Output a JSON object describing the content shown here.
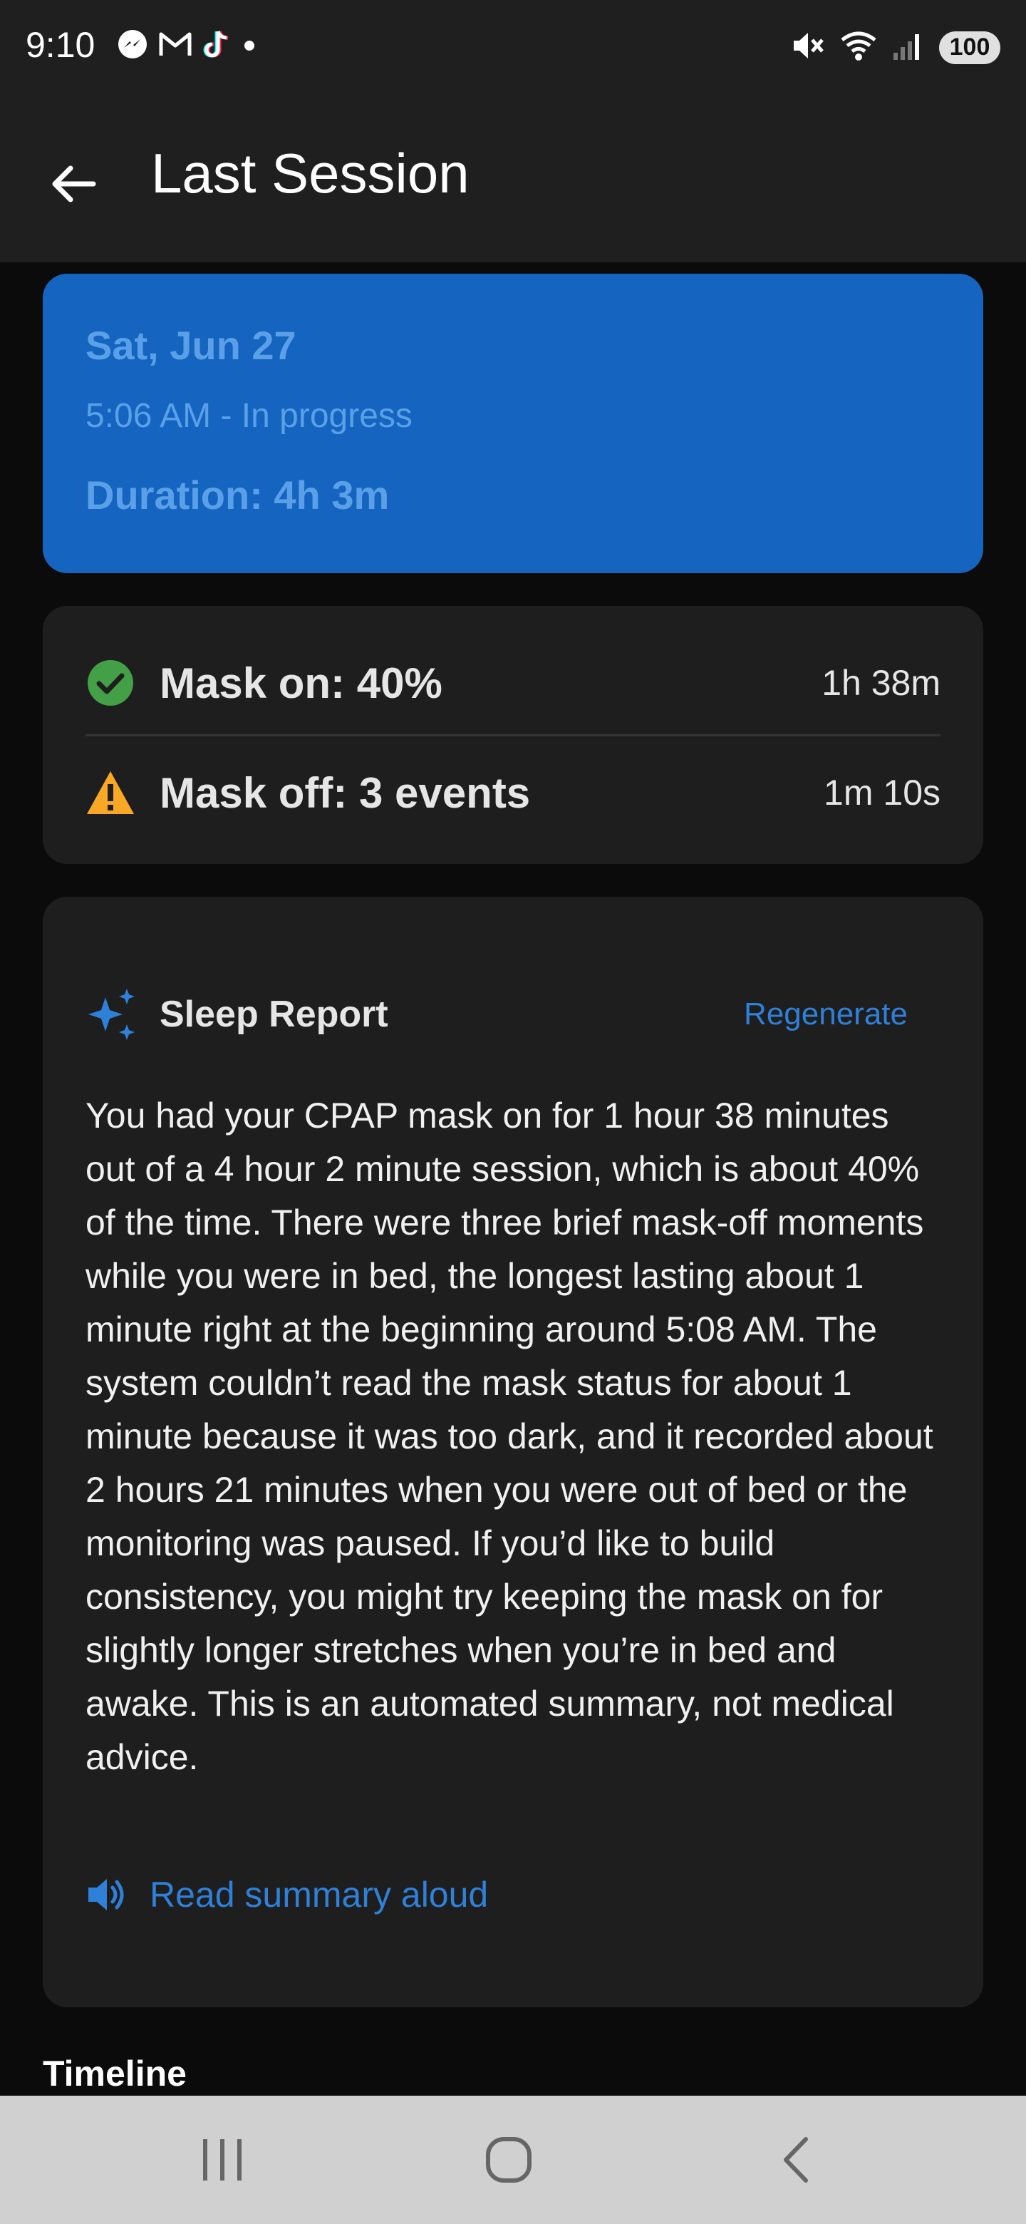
{
  "status_bar": {
    "time": "9:10",
    "battery": "100",
    "notification_icons": [
      "messenger-icon",
      "gmail-icon",
      "tiktok-icon",
      "dot-icon"
    ],
    "system_icons": [
      "mute-icon",
      "wifi-icon",
      "signal-icon",
      "battery-icon"
    ]
  },
  "app_bar": {
    "title": "Last Session"
  },
  "session": {
    "date": "Sat, Jun 27",
    "time_status": "5:06 AM - In progress",
    "duration": "Duration: 4h 3m"
  },
  "mask": {
    "on_label": "Mask on: 40%",
    "on_value": "1h 38m",
    "off_label": "Mask off: 3 events",
    "off_value": "1m 10s"
  },
  "report": {
    "title": "Sleep Report",
    "regenerate": "Regenerate",
    "body": "You had your CPAP mask on for 1 hour 38 minutes out of a 4 hour 2 minute session, which is about 40% of the time. There were three brief mask-off moments while you were in bed, the longest lasting about 1 minute right at the beginning around 5:08 AM. The system couldn’t read the mask status for about 1 minute because it was too dark, and it recorded about 2 hours 21 minutes when you were out of bed or the monitoring was paused. If you’d like to build consistency, you might try keeping the mask on for slightly longer stretches when you’re in bed and awake. This is an automated summary, not medical advice.",
    "read_aloud": "Read summary aloud"
  },
  "timeline": {
    "heading": "Timeline"
  },
  "colors": {
    "accent": "#2f80d8",
    "session_card": "#1565c0",
    "card": "#1e1e1e",
    "success": "#43a047",
    "warning": "#f9a825"
  }
}
